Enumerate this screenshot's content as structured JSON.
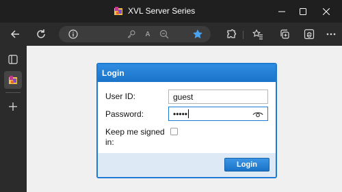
{
  "window": {
    "title": "XVL Server Series",
    "icons": {
      "app": "xvl-app-icon",
      "minimize": "minimize-icon",
      "maximize": "maximize-icon",
      "close": "close-icon"
    }
  },
  "toolbar": {
    "icons": [
      "back-icon",
      "refresh-icon",
      "info-icon",
      "key-icon",
      "read-aloud-icon",
      "zoom-out-icon",
      "favorite-star-icon",
      "extensions-icon",
      "favorites-icon",
      "collections-icon",
      "edge-icon",
      "more-icon"
    ],
    "read_aloud_text": "A",
    "colors": {
      "star": "#4aa3f0"
    }
  },
  "sidebar": {
    "icons": [
      "tab-actions-icon",
      "xvl-tab-icon",
      "new-tab-plus-icon"
    ]
  },
  "login": {
    "title": "Login",
    "user_id_label": "User ID:",
    "user_id_value": "guest",
    "password_label": "Password:",
    "password_value": "•••••",
    "keep_signed_label": "Keep me signed in:",
    "keep_signed_checked": false,
    "login_button": "Login",
    "colors": {
      "header": "#1c7ad2",
      "footer": "#dde9f4",
      "button": "#1a73c8"
    }
  }
}
